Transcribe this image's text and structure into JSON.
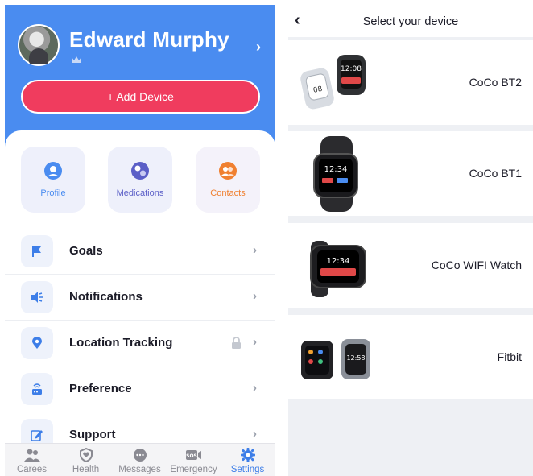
{
  "profile": {
    "name": "Edward Murphy"
  },
  "add_device": {
    "label": "+ Add Device"
  },
  "tiles": [
    {
      "label": "Profile"
    },
    {
      "label": "Medications"
    },
    {
      "label": "Contacts"
    }
  ],
  "menu": [
    {
      "label": "Goals",
      "icon": "flag-icon"
    },
    {
      "label": "Notifications",
      "icon": "speaker-icon"
    },
    {
      "label": "Location Tracking",
      "icon": "location-pin-icon",
      "locked": true
    },
    {
      "label": "Preference",
      "icon": "router-icon"
    },
    {
      "label": "Support",
      "icon": "edit-icon"
    }
  ],
  "tabbar": [
    {
      "label": "Carees",
      "icon": "people-icon"
    },
    {
      "label": "Health",
      "icon": "shield-heart-icon"
    },
    {
      "label": "Messages",
      "icon": "chat-icon"
    },
    {
      "label": "Emergency",
      "icon": "sos-icon"
    },
    {
      "label": "Settings",
      "icon": "gear-icon",
      "active": true
    }
  ],
  "device_picker": {
    "title": "Select your device",
    "devices": [
      {
        "name": "CoCo BT2"
      },
      {
        "name": "CoCo BT1"
      },
      {
        "name": "CoCo WIFI Watch"
      },
      {
        "name": "Fitbit"
      }
    ]
  },
  "colors": {
    "hero": "#4a8cf0",
    "add_button": "#f03c5e",
    "active_tab": "#3d7ee8"
  }
}
